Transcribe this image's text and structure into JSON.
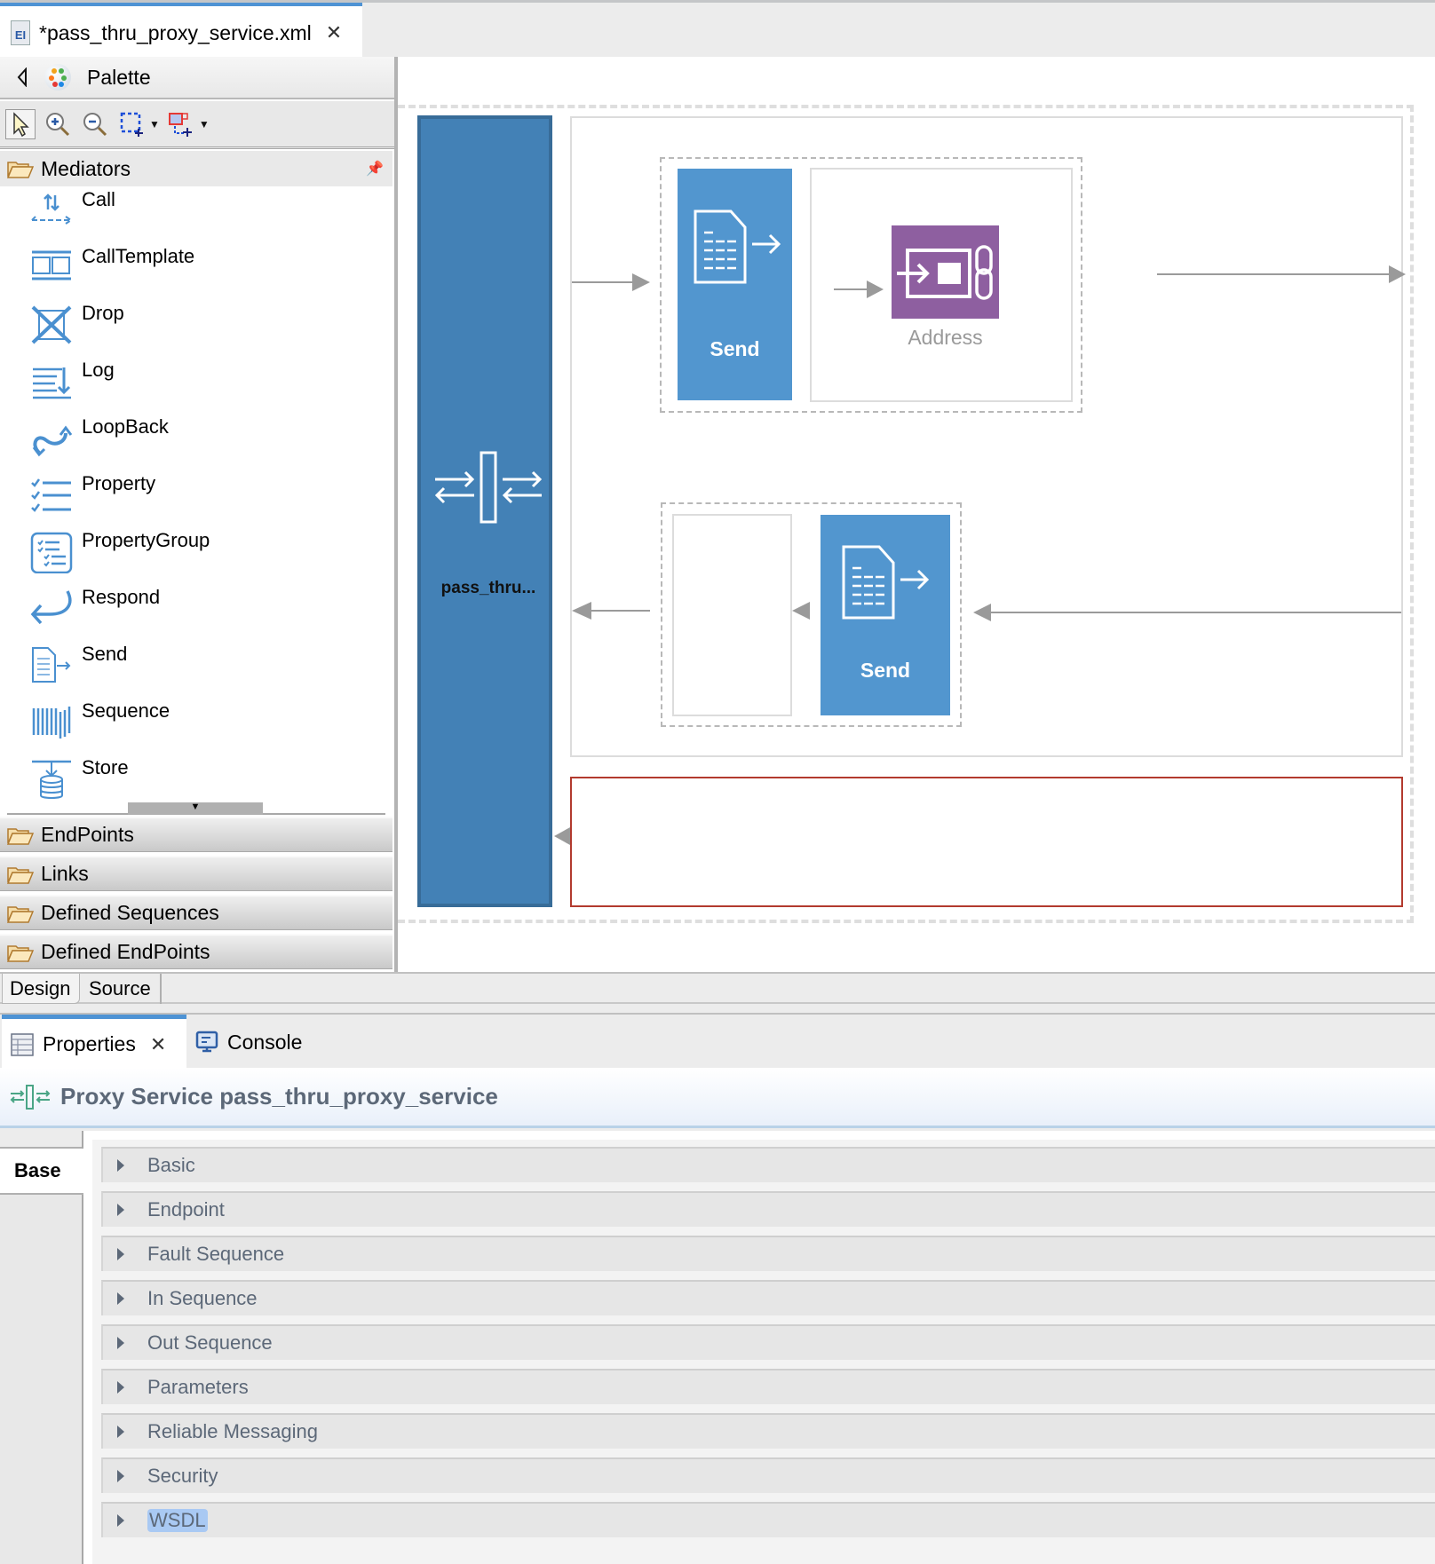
{
  "editor": {
    "tab_title": "*pass_thru_proxy_service.xml",
    "tab_icon": "EI"
  },
  "palette": {
    "title": "Palette",
    "toolbar": [
      "select-tool",
      "zoom-in-tool",
      "zoom-out-tool",
      "marquee-tool",
      "connection-creation-tool"
    ],
    "mediators_drawer": "Mediators",
    "tools": [
      {
        "label": "Call",
        "icon": "call-icon"
      },
      {
        "label": "CallTemplate",
        "icon": "call-template-icon"
      },
      {
        "label": "Drop",
        "icon": "drop-icon"
      },
      {
        "label": "Log",
        "icon": "log-icon"
      },
      {
        "label": "LoopBack",
        "icon": "loopback-icon"
      },
      {
        "label": "Property",
        "icon": "property-icon"
      },
      {
        "label": "PropertyGroup",
        "icon": "property-group-icon"
      },
      {
        "label": "Respond",
        "icon": "respond-icon"
      },
      {
        "label": "Send",
        "icon": "send-icon"
      },
      {
        "label": "Sequence",
        "icon": "sequence-icon"
      },
      {
        "label": "Store",
        "icon": "store-icon"
      }
    ],
    "drawers": [
      "EndPoints",
      "Links",
      "Defined Sequences",
      "Defined EndPoints"
    ]
  },
  "canvas": {
    "proxy_label": "pass_thru...",
    "in_sequence": {
      "send_label": "Send",
      "endpoint_label": "Address"
    },
    "out_sequence": {
      "send_label": "Send"
    },
    "colors": {
      "proxy": "#4381b6",
      "send": "#5296cf",
      "address": "#8e5fa0",
      "fault_border": "#b23a2e"
    }
  },
  "editor_tabs": {
    "design": "Design",
    "source": "Source"
  },
  "views": {
    "properties": "Properties",
    "console": "Console"
  },
  "properties": {
    "title": "Proxy Service pass_thru_proxy_service",
    "tab": "Base",
    "sections": [
      "Basic",
      "Endpoint",
      "Fault Sequence",
      "In Sequence",
      "Out Sequence",
      "Parameters",
      "Reliable Messaging",
      "Security",
      "WSDL"
    ],
    "selected_section_text": "WSDL"
  }
}
